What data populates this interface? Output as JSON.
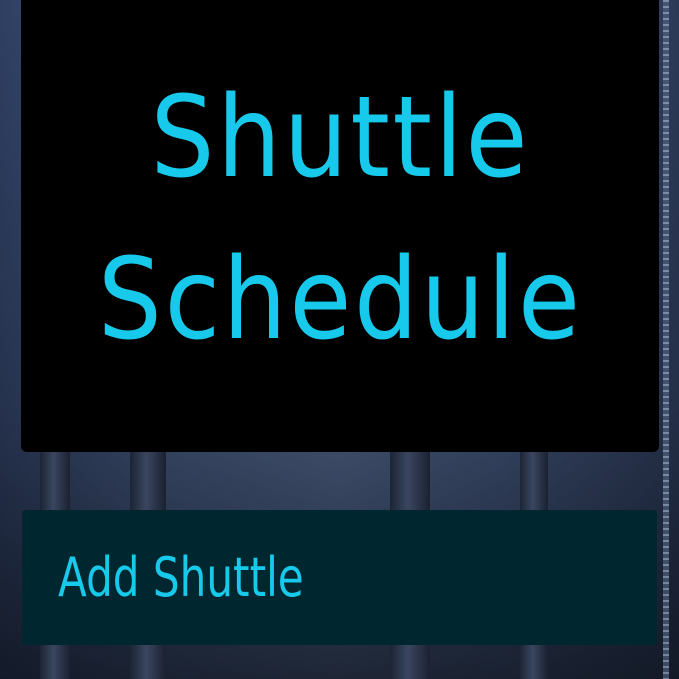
{
  "header": {
    "title_line1": "Shuttle",
    "title_line2": "Schedule"
  },
  "actions": {
    "add_shuttle_label": "Add Shuttle"
  },
  "colors": {
    "accent": "#17c9ea",
    "title_card_bg": "#000000",
    "button_bg": "#00272f"
  }
}
